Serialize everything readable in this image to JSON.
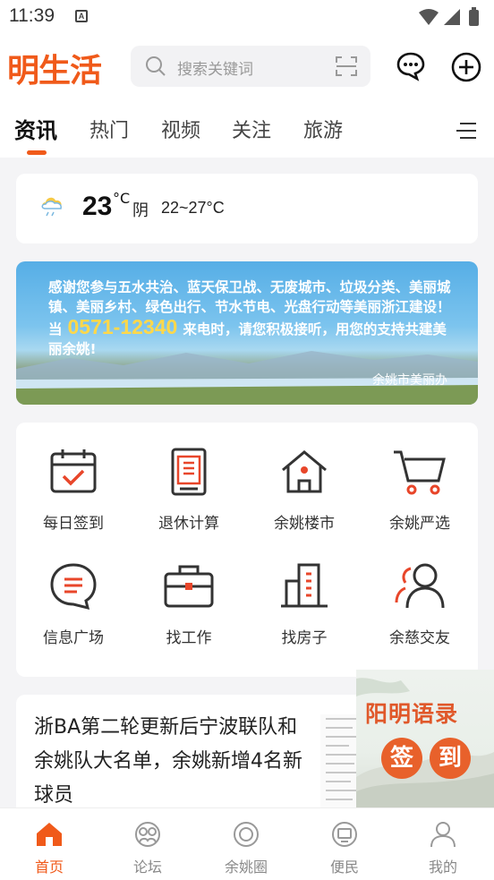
{
  "status_bar": {
    "time": "11:39",
    "notification_letter": "A"
  },
  "header": {
    "logo": "明生活",
    "search_placeholder": "搜索关键词",
    "tabs": [
      {
        "label": "资讯",
        "active": true
      },
      {
        "label": "热门",
        "active": false
      },
      {
        "label": "视频",
        "active": false
      },
      {
        "label": "关注",
        "active": false
      },
      {
        "label": "旅游",
        "active": false
      }
    ]
  },
  "weather": {
    "temperature": "23",
    "unit": "°C",
    "condition": "阴",
    "range": "22~27°C",
    "icon": "cloud-rain-icon"
  },
  "banner": {
    "text_before": "感谢您参与五水共治、蓝天保卫战、无废城市、垃圾分类、美丽城镇、美丽乡村、绿色出行、节水节电、光盘行动等美丽浙江建设！当",
    "phone": "0571-12340",
    "text_after": "来电时，请您积极接听，用您的支持共建美丽余姚!",
    "credit": "余姚市美丽办"
  },
  "services": [
    {
      "label": "每日签到",
      "icon": "calendar-check-icon"
    },
    {
      "label": "退休计算",
      "icon": "retirement-doc-icon"
    },
    {
      "label": "余姚楼市",
      "icon": "house-icon"
    },
    {
      "label": "余姚严选",
      "icon": "cart-icon"
    },
    {
      "label": "信息广场",
      "icon": "message-list-icon"
    },
    {
      "label": "找工作",
      "icon": "briefcase-icon"
    },
    {
      "label": "找房子",
      "icon": "buildings-icon"
    },
    {
      "label": "余慈交友",
      "icon": "friends-icon"
    }
  ],
  "news": {
    "title": "浙BA第二轮更新后宁波联队和余姚队大名单，余姚新增4名新球员"
  },
  "promo": {
    "title": "阳明语录",
    "circle_1": "签",
    "circle_2": "到"
  },
  "bottom_nav": [
    {
      "label": "首页",
      "icon": "home-icon",
      "active": true
    },
    {
      "label": "论坛",
      "icon": "forum-icon",
      "active": false
    },
    {
      "label": "余姚圈",
      "icon": "circle-icon",
      "active": false
    },
    {
      "label": "便民",
      "icon": "service-monitor-icon",
      "active": false
    },
    {
      "label": "我的",
      "icon": "profile-icon",
      "active": false
    }
  ],
  "colors": {
    "accent": "#f05a1a",
    "phone_highlight": "#ffd84a",
    "icon_dark": "#333333",
    "icon_red": "#e8462a"
  }
}
